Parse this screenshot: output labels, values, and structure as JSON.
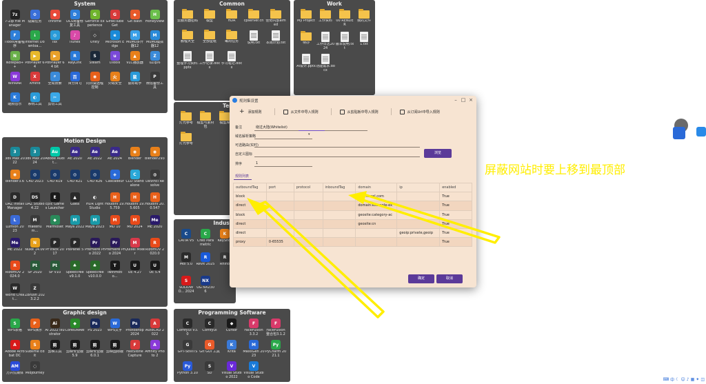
{
  "fences": {
    "system": {
      "title": "System",
      "items": [
        {
          "label": "7-Zip File Manager",
          "glyph": "7z",
          "color": "#222222"
        },
        {
          "label": "隐藏任务",
          "glyph": "⚙",
          "color": "#3a6fd8"
        },
        {
          "label": "chrome",
          "glyph": "●",
          "color": "#e84a3a"
        },
        {
          "label": "DLS常备修复工具",
          "glyph": "D",
          "color": "#2e7fd9"
        },
        {
          "label": "GeForce Experience",
          "glyph": "G",
          "color": "#6fb42c"
        },
        {
          "label": "GifskiTubeGet",
          "glyph": "G",
          "color": "#d83a3a"
        },
        {
          "label": "Git Bash",
          "glyph": "◆",
          "color": "#e85a2a"
        },
        {
          "label": "Honeyview",
          "glyph": "H",
          "color": "#6abf4b"
        },
        {
          "label": "iTools常备程序",
          "glyph": "F",
          "color": "#2e7fd9"
        },
        {
          "label": "Internet Downloa...",
          "glyph": "↓",
          "color": "#2aa84a"
        },
        {
          "label": "Isx",
          "glyph": "◎",
          "color": "#2a9bd8"
        },
        {
          "label": "iTunes",
          "glyph": "♪",
          "color": "#d84aa8"
        },
        {
          "label": "Unity",
          "glyph": "◇",
          "color": "#444444"
        },
        {
          "label": "Microsoft Edge",
          "glyph": "e",
          "color": "#1a8ad8"
        },
        {
          "label": "MuMu多开器12",
          "glyph": "M",
          "color": "#3aa0e8"
        },
        {
          "label": "MuMu模拟器12",
          "glyph": "M",
          "color": "#2a8ad8"
        },
        {
          "label": "Notepad++",
          "glyph": "N",
          "color": "#6ab04a"
        },
        {
          "label": "PotPlayer 64",
          "glyph": "▶",
          "color": "#e8b82a"
        },
        {
          "label": "PotPlayer 64 bit",
          "glyph": "▶",
          "color": "#e8a02a"
        },
        {
          "label": "RayLink",
          "glyph": "R",
          "color": "#2a7ad8"
        },
        {
          "label": "Steam",
          "glyph": "S",
          "color": "#1b2838"
        },
        {
          "label": "uTools",
          "glyph": "u",
          "color": "#7a4ad8"
        },
        {
          "label": "VLC播放器",
          "glyph": "▲",
          "color": "#e8801a"
        },
        {
          "label": "uZip/6",
          "glyph": "Z",
          "color": "#3a8ad8"
        },
        {
          "label": "WinRAR",
          "glyph": "W",
          "color": "#8a3ad8"
        },
        {
          "label": "Xmind",
          "glyph": "X",
          "color": "#d83a3a"
        },
        {
          "label": "全局搜索",
          "glyph": "⌕",
          "color": "#3a8ad8"
        },
        {
          "label": "百分百TJ",
          "glyph": "百",
          "color": "#2a6ad8"
        },
        {
          "label": "向日葵远程控制",
          "glyph": "◉",
          "color": "#e8601a"
        },
        {
          "label": "火绒安全",
          "glyph": "火",
          "color": "#e8801a"
        },
        {
          "label": "鼠标助手",
          "glyph": "鼠",
          "color": "#2a9ad8"
        },
        {
          "label": "微信备份工具",
          "glyph": "P",
          "color": "#3a3a3a"
        },
        {
          "label": "酷狗音乐",
          "glyph": "K",
          "color": "#2a7ad8"
        },
        {
          "label": "系统工具",
          "glyph": "◐",
          "color": "#2a9ad8"
        },
        {
          "label": "剪切工具",
          "glyph": "✂",
          "color": "#3aa8e8"
        }
      ]
    },
    "common": {
      "title": "Common",
      "items": [
        {
          "label": "云服务器密码",
          "type": "folder"
        },
        {
          "label": "模型",
          "type": "folder"
        },
        {
          "label": "HDR",
          "type": "folder"
        },
        {
          "label": "cpserver.cn",
          "type": "folder"
        },
        {
          "label": "佳奇内部aimed",
          "type": "folder"
        },
        {
          "label": "教程大全",
          "type": "folder"
        },
        {
          "label": "全部壁纸",
          "type": "folder"
        },
        {
          "label": "每周任务",
          "type": "folder"
        },
        {
          "label": "说明.txt",
          "type": "doc"
        },
        {
          "label": "本周计划.txt",
          "type": "doc"
        },
        {
          "label": "整理学习资料.pptx",
          "type": "doc"
        },
        {
          "label": "工作记录.docx",
          "type": "doc"
        },
        {
          "label": "学习笔记.docx",
          "type": "doc"
        }
      ]
    },
    "work": {
      "title": "Work",
      "items": [
        {
          "label": "My Project",
          "type": "folder"
        },
        {
          "label": "工作资料",
          "type": "folder"
        },
        {
          "label": "00 RENDER",
          "type": "folder"
        },
        {
          "label": "我的文件",
          "type": "folder"
        },
        {
          "label": "待办",
          "type": "folder"
        },
        {
          "label": "工作日志2024",
          "type": "doc"
        },
        {
          "label": "版本说明.txt",
          "type": "doc"
        },
        {
          "label": "1.txt",
          "type": "doc"
        },
        {
          "label": "AI设计.pptx",
          "type": "doc"
        },
        {
          "label": "功能需求.docx",
          "type": "doc"
        }
      ]
    },
    "motion": {
      "title": "Motion Design",
      "items": [
        {
          "label": "3ds Max 2022",
          "glyph": "3",
          "color": "#1a8a9a"
        },
        {
          "label": "3ds Max 2024",
          "glyph": "3",
          "color": "#1a8a9a"
        },
        {
          "label": "Adobe Audit...",
          "glyph": "Au",
          "color": "#00c8a8"
        },
        {
          "label": "AE 2020",
          "glyph": "Ae",
          "color": "#3a2a8a"
        },
        {
          "label": "AE 2022",
          "glyph": "Ae",
          "color": "#3a2a8a"
        },
        {
          "label": "AE 2024",
          "glyph": "Ae",
          "color": "#3a2a8a"
        },
        {
          "label": "Blender",
          "glyph": "◉",
          "color": "#e8801a"
        },
        {
          "label": "blender293",
          "glyph": "◉",
          "color": "#e8801a"
        },
        {
          "label": "blender3.6",
          "glyph": "◉",
          "color": "#e8801a"
        },
        {
          "label": "C4D 2023",
          "glyph": "◎",
          "color": "#1a3a6a"
        },
        {
          "label": "C4D R19",
          "glyph": "◎",
          "color": "#1a3a6a"
        },
        {
          "label": "C4D R21",
          "glyph": "◎",
          "color": "#1a3a6a"
        },
        {
          "label": "C4D R26",
          "glyph": "◎",
          "color": "#1a3a6a"
        },
        {
          "label": "Cascadeur",
          "glyph": "◈",
          "color": "#2a6ad8"
        },
        {
          "label": "CLO Standalone",
          "glyph": "C",
          "color": "#2aa8d8"
        },
        {
          "label": "DaVinci Resolve",
          "glyph": "◍",
          "color": "#3a3a3a"
        },
        {
          "label": "DAZ Install Manager",
          "glyph": "D",
          "color": "#2a2a2a"
        },
        {
          "label": "DAZ Studio 4.22",
          "glyph": "DS",
          "color": "#2a2a2a"
        },
        {
          "label": "Epic Games Launcher",
          "glyph": "E",
          "color": "#1a1a1a"
        },
        {
          "label": "Gaea",
          "glyph": "▲",
          "color": "#2a2a2a"
        },
        {
          "label": "HDR Light Studio",
          "glyph": "◐",
          "color": "#4a4a4a"
        },
        {
          "label": "Houdini 19.5.759",
          "glyph": "H",
          "color": "#e8601a"
        },
        {
          "label": "Houdini 19.5.605",
          "glyph": "H",
          "color": "#e8601a"
        },
        {
          "label": "Houdini 20.0.547",
          "glyph": "H",
          "color": "#e8601a"
        },
        {
          "label": "Lumion 2023",
          "glyph": "L",
          "color": "#3a6ad8"
        },
        {
          "label": "makehum...",
          "glyph": "M",
          "color": "#3a3a3a"
        },
        {
          "label": "Marmoset",
          "glyph": "◆",
          "color": "#2a8a5a"
        },
        {
          "label": "Maya 2022",
          "glyph": "M",
          "color": "#1a9aa8"
        },
        {
          "label": "Maya 2023",
          "glyph": "M",
          "color": "#1a9aa8"
        },
        {
          "label": "MD 10",
          "glyph": "M",
          "color": "#e84a1a"
        },
        {
          "label": "MD 2024",
          "glyph": "M",
          "color": "#e84a1a"
        },
        {
          "label": "ME 2020",
          "glyph": "Me",
          "color": "#2a1a6a"
        },
        {
          "label": "ME 2022",
          "glyph": "Me",
          "color": "#2a1a6a"
        },
        {
          "label": "Nuke 14.0v2",
          "glyph": "N",
          "color": "#e8a01a"
        },
        {
          "label": "PFTrack 2017",
          "glyph": "P",
          "color": "#2a2a2a"
        },
        {
          "label": "PixPanel 5",
          "glyph": "P",
          "color": "#2a2a2a"
        },
        {
          "label": "Premiere Pro 2022",
          "glyph": "Pr",
          "color": "#2a1a5a"
        },
        {
          "label": "Premiere Pro 2024",
          "glyph": "Pr",
          "color": "#2a1a5a"
        },
        {
          "label": "Quixel Mixer",
          "glyph": "M",
          "color": "#d83a4a"
        },
        {
          "label": "RizomUV 2020.0",
          "glyph": "R",
          "color": "#e84a1a"
        },
        {
          "label": "RizomUV 2024.0",
          "glyph": "R",
          "color": "#e84a1a"
        },
        {
          "label": "SP 2020",
          "glyph": "Pt",
          "color": "#2a5a3a"
        },
        {
          "label": "SP V10",
          "glyph": "Pt",
          "color": "#2a5a3a"
        },
        {
          "label": "SpeedTree v9.1.0",
          "glyph": "♣",
          "color": "#2a6a2a"
        },
        {
          "label": "SpeedTree v10.0.0",
          "glyph": "♣",
          "color": "#2a6a2a"
        },
        {
          "label": "Twinmotio...",
          "glyph": "T",
          "color": "#1a1a1a"
        },
        {
          "label": "UE 4.27",
          "glyph": "U",
          "color": "#1a1a1a"
        },
        {
          "label": "UE 5.4",
          "glyph": "U",
          "color": "#1a1a1a"
        },
        {
          "label": "World Creat...",
          "glyph": "W",
          "color": "#2a2a2a"
        },
        {
          "label": "ZBrush 2023.2.2",
          "glyph": "Z",
          "color": "#3a3a3a"
        }
      ]
    },
    "graphic": {
      "title": "Graphic design",
      "items": [
        {
          "label": "WPS表格",
          "glyph": "S",
          "color": "#2aa84a"
        },
        {
          "label": "WPS演示",
          "glyph": "P",
          "color": "#e8601a"
        },
        {
          "label": "AI 2022 Illustrator",
          "glyph": "Ai",
          "color": "#3a2a1a"
        },
        {
          "label": "CorelDRAW",
          "glyph": "◆",
          "color": "#2a8a2a"
        },
        {
          "label": "PS 2023",
          "glyph": "Ps",
          "color": "#1a2a5a"
        },
        {
          "label": "WPS文字",
          "glyph": "W",
          "color": "#2a6ad8"
        },
        {
          "label": "Photoshop 2024",
          "glyph": "Ps",
          "color": "#1a2a5a"
        },
        {
          "label": "AutoCAD 2022",
          "glyph": "A",
          "color": "#d83a3a"
        },
        {
          "label": "Adobe Acrobat DC",
          "glyph": "A",
          "color": "#d81a1a"
        },
        {
          "label": "Sublime Edit",
          "glyph": "S",
          "color": "#e8801a"
        },
        {
          "label": "剪映工具",
          "glyph": "剪",
          "color": "#1a1a1a"
        },
        {
          "label": "剪映专业版 5.9",
          "glyph": "剪",
          "color": "#1a1a1a"
        },
        {
          "label": "剪映专业版 6.0.1",
          "glyph": "剪",
          "color": "#1a1a1a"
        },
        {
          "label": "剪映国际版",
          "glyph": "剪",
          "color": "#1a1a1a"
        },
        {
          "label": "FastStone Capture",
          "glyph": "F",
          "color": "#d83a3a"
        },
        {
          "label": "Affinity Photo 2",
          "glyph": "A",
          "color": "#8a3ad8"
        },
        {
          "label": "万兴优媒体",
          "glyph": "AM",
          "color": "#2a4ad8"
        },
        {
          "label": "Midjourney",
          "glyph": "◌",
          "color": "#3a3a3a"
        }
      ]
    },
    "programming": {
      "title": "Programming Software",
      "items": [
        {
          "label": "ComfyUI V3.0",
          "glyph": "C",
          "color": "#2a2a2a"
        },
        {
          "label": "ComfyUI",
          "glyph": "C",
          "color": "#2a2a2a"
        },
        {
          "label": "Cursor",
          "glyph": "◆",
          "color": "#1a1a1a"
        },
        {
          "label": "FaceFusion 3.3.2",
          "glyph": "F",
          "color": "#d83a6a"
        },
        {
          "label": "FaceFusion 整合包3.1.2",
          "glyph": "F",
          "color": "#d83a6a"
        },
        {
          "label": "GPT-SoVITS",
          "glyph": "G",
          "color": "#3a3a3a"
        },
        {
          "label": "Git GUI 工具",
          "glyph": "G",
          "color": "#e85a2a"
        },
        {
          "label": "Krita",
          "glyph": "K",
          "color": "#3a7ad8"
        },
        {
          "label": "MaxxGen 2023",
          "glyph": "M",
          "color": "#2a6ad8"
        },
        {
          "label": "PyCharm 2021.1",
          "glyph": "Py",
          "color": "#2aa84a"
        },
        {
          "label": "Python 3.10",
          "glyph": "Py",
          "color": "#2a5ad8"
        },
        {
          "label": "SD",
          "glyph": "S",
          "color": "#3a3a3a"
        },
        {
          "label": "Visual Studio 2022",
          "glyph": "V",
          "color": "#6a2ad8"
        },
        {
          "label": "Visual Studio Code",
          "glyph": "V",
          "color": "#1a7ad8"
        }
      ]
    },
    "template": {
      "title": "Tem",
      "items": [
        {
          "label": "灯光参考",
          "type": "folder"
        },
        {
          "label": "模型与素材包",
          "type": "folder"
        },
        {
          "label": "模型库",
          "type": "folder"
        },
        {
          "label": "灯光参考",
          "type": "folder"
        }
      ]
    },
    "industry": {
      "title": "Industr",
      "items": [
        {
          "label": "CATIA V5",
          "glyph": "C",
          "color": "#1a4a8a"
        },
        {
          "label": "Creo Parametric",
          "glyph": "C",
          "color": "#2aa84a"
        },
        {
          "label": "KeyShot",
          "glyph": "K",
          "color": "#e8801a"
        },
        {
          "label": "Moi 5.0",
          "glyph": "M",
          "color": "#2a2a2a"
        },
        {
          "label": "Revit 2025",
          "glyph": "R",
          "color": "#1a5ad8"
        },
        {
          "label": "Rhino",
          "glyph": "R",
          "color": "#3a3a3a"
        },
        {
          "label": "SOLIDWO... 2024",
          "glyph": "S",
          "color": "#d81a1a"
        },
        {
          "label": "UG NX2306",
          "glyph": "NX",
          "color": "#1a3a8a"
        }
      ]
    }
  },
  "dialog": {
    "title": "规则集设置",
    "toolbar": {
      "add": "添加规则",
      "import_file": "从文件中导入规则",
      "import_clipboard": "从剪贴板中导入规则",
      "import_sub": "从订阅Url中导入规则"
    },
    "form": {
      "remark_label": "备注",
      "remark_value": "绕过大陆(Whitelist)",
      "domain_strategy_label": "域名解析策略",
      "outbound_label": "可选路由(实时)",
      "custom_icon_label": "自定义图标",
      "browse_label": "浏览",
      "order_label": "排序",
      "order_value": "1"
    },
    "list_tab": "规则列表",
    "table": {
      "columns": [
        "outboundTag",
        "port",
        "protocol",
        "inboundTag",
        "domain",
        "ip",
        "enabled"
      ],
      "rows": [
        [
          "block",
          "",
          "",
          "",
          "api.mzwel.com",
          "",
          "True"
        ],
        [
          "direct",
          "",
          "",
          "",
          "domain:example-ex",
          "",
          "True"
        ],
        [
          "block",
          "",
          "",
          "",
          "geosite:category-ac",
          "",
          "True"
        ],
        [
          "direct",
          "",
          "",
          "",
          "geosite:cn",
          "",
          "True"
        ],
        [
          "direct",
          "",
          "",
          "",
          "",
          "geoip:private,geoip",
          "True"
        ],
        [
          "proxy",
          "0-65535",
          "",
          "",
          "",
          "",
          "True"
        ]
      ]
    },
    "confirm": "确定",
    "cancel": "取消"
  },
  "annotation": {
    "text": "屏蔽网站时要上移到最顶部",
    "color": "#ffee00"
  },
  "colors": {
    "fence_bg": "#4a4a4a",
    "dialog_bg": "#f7e4d2",
    "accent": "#5b3a99"
  }
}
